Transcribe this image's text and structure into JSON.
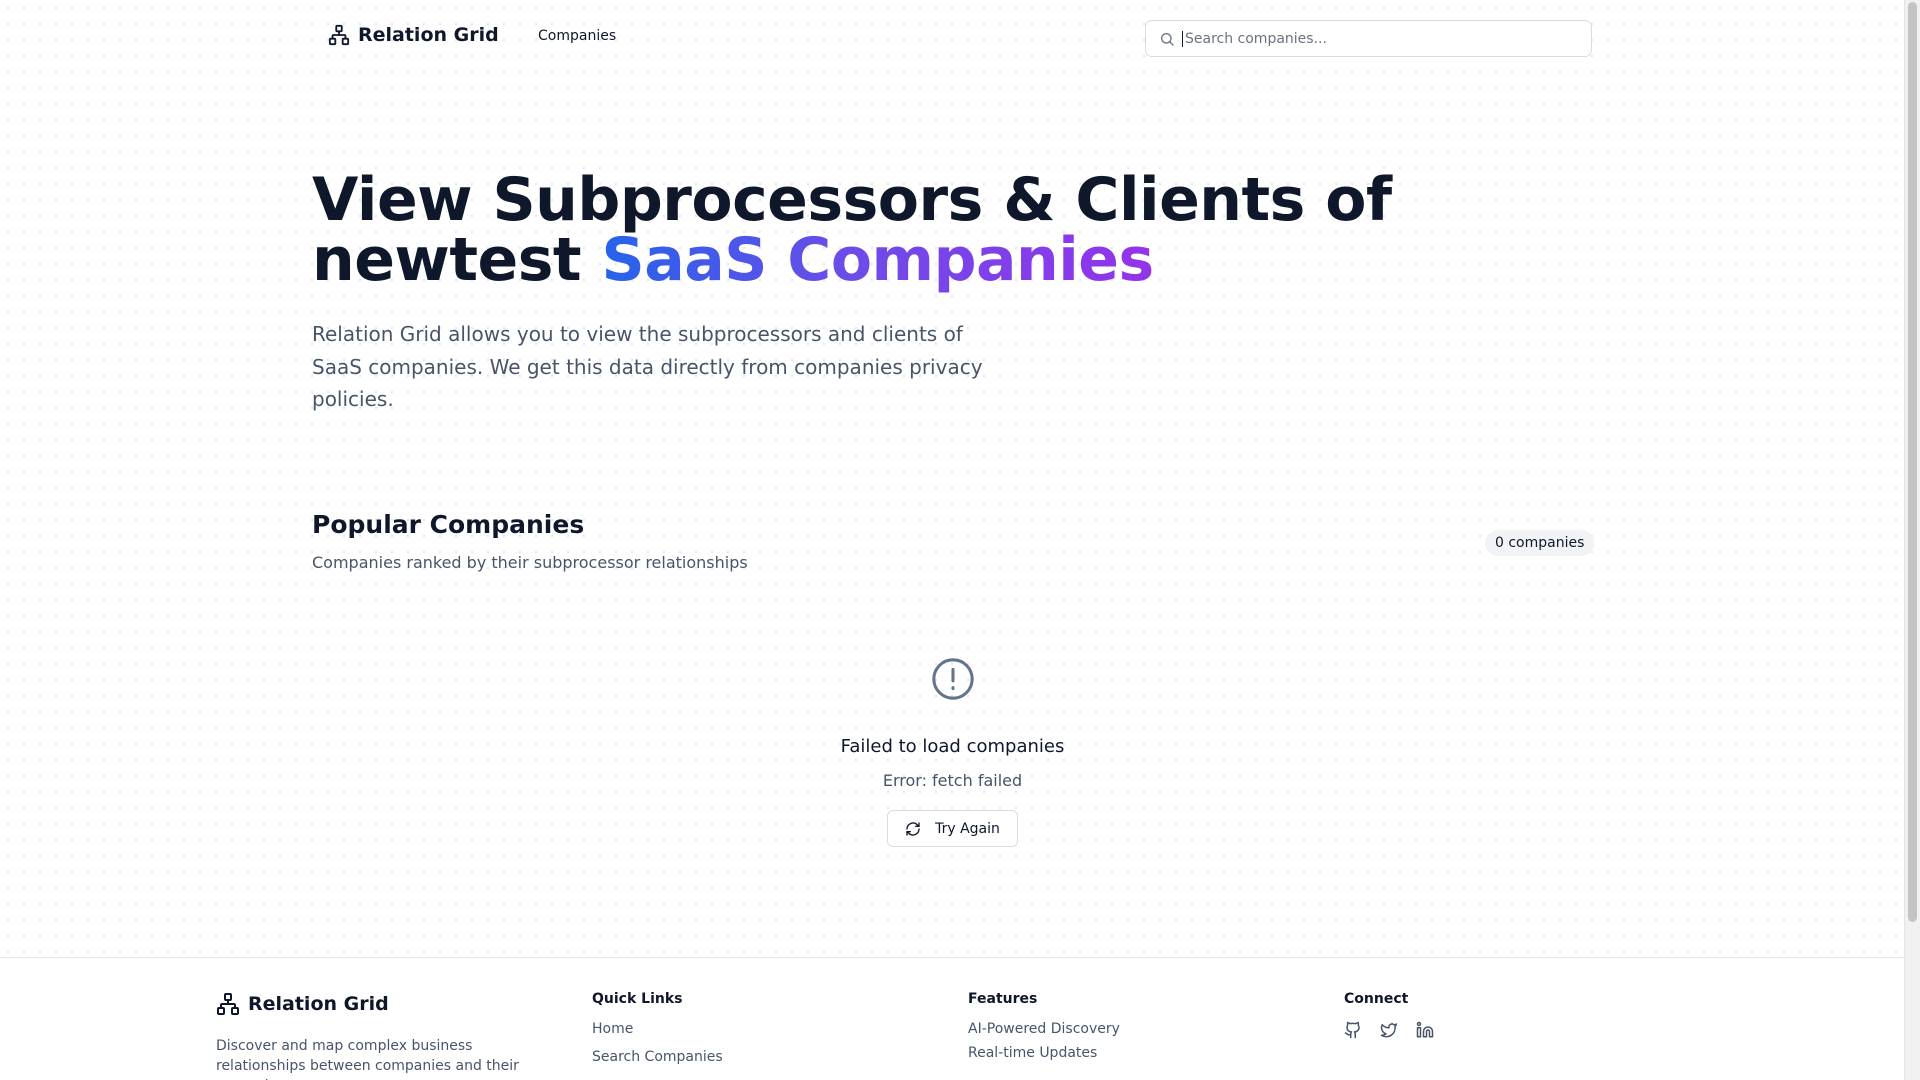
{
  "header": {
    "brand": "Relation Grid",
    "nav_companies": "Companies",
    "search_placeholder": "Search companies..."
  },
  "hero": {
    "title_part1": "View Subprocessors & Clients of newtest ",
    "title_highlight": "SaaS Companies",
    "description": "Relation Grid allows you to view the subprocessors and clients of SaaS companies. We get this data directly from companies privacy policies."
  },
  "popular": {
    "title": "Popular Companies",
    "subtitle": "Companies ranked by their subprocessor relationships",
    "count_badge": "0 companies"
  },
  "error": {
    "title": "Failed to load companies",
    "message": "Error: fetch failed",
    "retry_label": "Try Again"
  },
  "footer": {
    "brand": "Relation Grid",
    "description": "Discover and map complex business relationships between companies and their networks.",
    "quick_links_heading": "Quick Links",
    "quick_links": [
      "Home",
      "Search Companies"
    ],
    "features_heading": "Features",
    "features": [
      "AI-Powered Discovery",
      "Real-time Updates"
    ],
    "connect_heading": "Connect"
  },
  "icons": {
    "brand": "network-icon",
    "search": "search-icon",
    "error": "alert-circle-icon",
    "retry": "refresh-icon",
    "social": [
      "github-icon",
      "twitter-icon",
      "linkedin-icon"
    ]
  },
  "colors": {
    "gradient_start": "#2563eb",
    "gradient_end": "#9333ea",
    "text_primary": "#0f172a",
    "text_muted": "#475569"
  }
}
